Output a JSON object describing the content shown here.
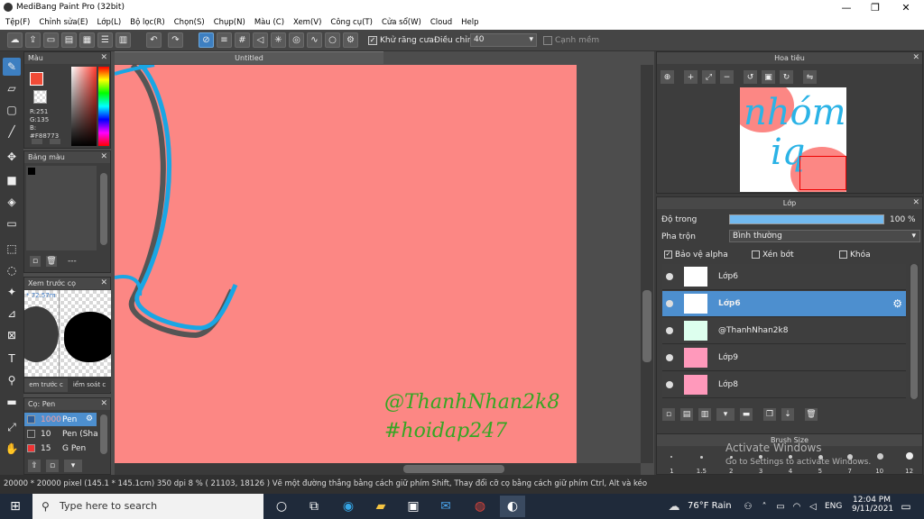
{
  "app": {
    "title": "MediBang Paint Pro (32bit)"
  },
  "menu": [
    "Tệp(F)",
    "Chỉnh sửa(E)",
    "Lớp(L)",
    "Bộ lọc(R)",
    "Chọn(S)",
    "Chụp(N)",
    "Màu (C)",
    "Xem(V)",
    "Công cụ(T)",
    "Cửa sổ(W)",
    "Cloud",
    "Help"
  ],
  "toolbar": {
    "antialias_label": "Khử răng cưa",
    "adjust_label": "Điều chỉnh",
    "adjust_value": "40",
    "snap_label": "Cạnh mềm"
  },
  "tab": {
    "title": "Untitled"
  },
  "color_panel": {
    "title": "Màu",
    "r": "R:251",
    "g": "G:135",
    "b": "B:",
    "hex": "#F88773",
    "main_color": "#fc8784"
  },
  "swatch_panel": {
    "title": "Bảng màu",
    "footer": "---"
  },
  "preview_panel": {
    "title": "Xem trước cọ",
    "zoom": "* 72.57m",
    "tab1": "em trước c",
    "tab2": "iểm soát c"
  },
  "brush_panel": {
    "title": "Cọ: Pen",
    "items": [
      {
        "size": "1000",
        "name": "Pen"
      },
      {
        "size": "10",
        "name": "Pen (Sha"
      },
      {
        "size": "15",
        "name": "G Pen"
      }
    ]
  },
  "canvas": {
    "watermark1": "@ThanhNhan2k8",
    "watermark2": "#hoidap247",
    "text_color": "#35a623"
  },
  "navigator": {
    "title": "Hoa tiêu",
    "art_text1": "nhóm",
    "art_text2": "iq"
  },
  "layer_panel": {
    "title": "Lớp",
    "opacity_label": "Độ trong",
    "opacity_value": "100 %",
    "blend_label": "Pha trộn",
    "blend_value": "Bình thường",
    "protect_alpha": "Bảo vệ alpha",
    "clip": "Xén bớt",
    "lock": "Khóa",
    "layers": [
      {
        "name": "Lớp6",
        "selected": false
      },
      {
        "name": "Lớp6",
        "selected": true
      },
      {
        "name": "@ThanhNhan2k8",
        "selected": false
      },
      {
        "name": "Lớp9",
        "selected": false
      },
      {
        "name": "Lớp8",
        "selected": false
      }
    ]
  },
  "brush_size": {
    "title": "Brush Size",
    "ticks": [
      "1",
      "1.5",
      "2",
      "3",
      "4",
      "5",
      "7",
      "10",
      "12"
    ],
    "activate1": "Activate Windows",
    "activate2": "Go to Settings to activate Windows."
  },
  "status": {
    "text": "20000 * 20000 pixel  (145.1 * 145.1cm)  350 dpi  8 %  ( 21103, 18126 )  Vẽ một đường thẳng bằng cách giữ phím Shift, Thay đổi cỡ cọ bằng cách giữ phím Ctrl, Alt và kéo"
  },
  "taskbar": {
    "search_placeholder": "Type here to search",
    "weather": "76°F  Rain",
    "lang": "ENG",
    "time": "12:04 PM",
    "date": "9/11/2021"
  }
}
